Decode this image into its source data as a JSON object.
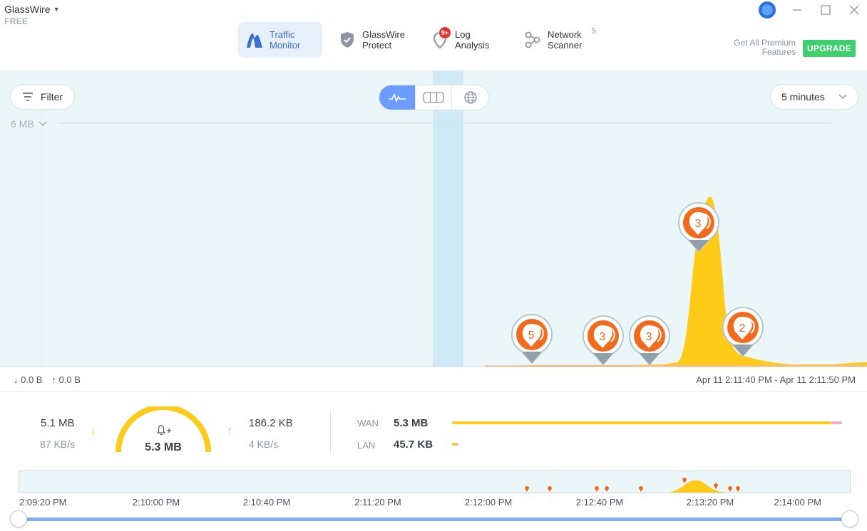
{
  "app": {
    "name": "GlassWire",
    "tier": "FREE"
  },
  "nav": {
    "tabs": [
      {
        "label_line1": "Traffic",
        "label_line2": "Monitor",
        "active": true,
        "icon": "traffic-monitor-icon"
      },
      {
        "label_line1": "GlassWire",
        "label_line2": "Protect",
        "active": false,
        "icon": "shield-check-icon"
      },
      {
        "label_line1": "Log",
        "label_line2": "Analysis",
        "active": false,
        "icon": "log-pin-icon",
        "badge": "9+"
      },
      {
        "label_line1": "Network",
        "label_line2": "Scanner",
        "active": false,
        "icon": "network-nodes-icon",
        "count": "5"
      }
    ]
  },
  "premium": {
    "line1": "Get All Premium",
    "line2": "Features",
    "upgrade_label": "UPGRADE"
  },
  "toolbar": {
    "filter_label": "Filter",
    "range_label": "5 minutes",
    "scale_label": "6 MB"
  },
  "graph": {
    "markers": [
      {
        "count": "5",
        "x_frac": 0.6135
      },
      {
        "count": "3",
        "x_frac": 0.6957
      },
      {
        "count": "3",
        "x_frac": 0.7492
      },
      {
        "count": "3",
        "x_frac": 0.8059
      },
      {
        "count": "2",
        "x_frac": 0.8569
      }
    ]
  },
  "info": {
    "download": "↓ 0.0 B",
    "upload": "↑ 0.0 B",
    "range": "Apr 11 2:11:40 PM - Apr 11 2:11:50 PM"
  },
  "stats": {
    "download_total": "5.1 MB",
    "download_rate": "87 KB/s",
    "total": "5.3 MB",
    "upload_total": "186.2 KB",
    "upload_rate": "4 KB/s",
    "wan_label": "WAN",
    "wan_value": "5.3 MB",
    "lan_label": "LAN",
    "lan_value": "45.7 KB"
  },
  "timeline": {
    "ticks": [
      "2:09:20 PM",
      "2:10:00 PM",
      "2:10:40 PM",
      "2:11:20 PM",
      "2:12:00 PM",
      "2:12:40 PM",
      "2:13:20 PM",
      "2:14:00 PM"
    ]
  },
  "colors": {
    "accent": "#6c9cff",
    "download": "#fdcb18",
    "upload": "#f7a8c8",
    "marker": "#f26a1b",
    "upgrade": "#3fcf6e"
  }
}
